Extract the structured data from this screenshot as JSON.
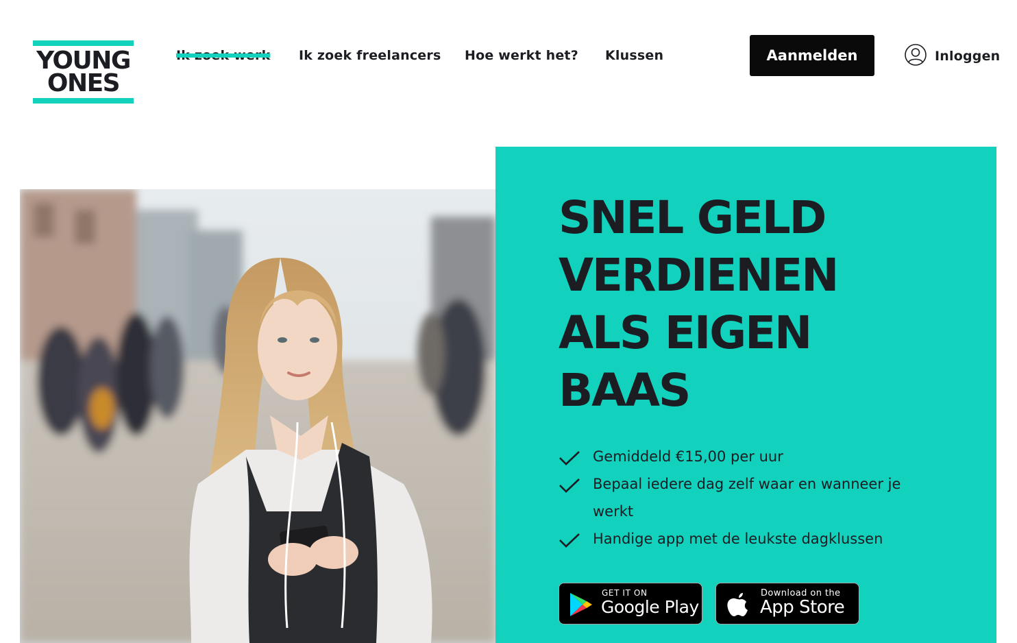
{
  "brand": {
    "logo_line1": "YOUNG",
    "logo_line2": "ONES",
    "accent_color": "#12d1bd"
  },
  "nav": {
    "items": [
      {
        "label": "Ik zoek werk",
        "active": true
      },
      {
        "label": "Ik zoek freelancers"
      },
      {
        "label": "Hoe werkt het?"
      },
      {
        "label": "Klussen"
      }
    ]
  },
  "header": {
    "signup_label": "Aanmelden",
    "login_label": "Inloggen",
    "login_icon": "user-circle-icon"
  },
  "hero": {
    "title_lines": [
      "SNEL GELD",
      "VERDIENEN",
      "ALS EIGEN",
      "BAAS"
    ],
    "benefits": [
      "Gemiddeld €15,00 per uur",
      "Bepaal iedere dag zelf waar en wanneer je werkt",
      "Handige app met de leukste dagklussen"
    ],
    "check_icon": "checkmark-icon",
    "panel_color": "#12d1bd"
  },
  "stores": {
    "google_play": {
      "small": "GET IT ON",
      "big": "Google Play",
      "icon": "google-play-icon"
    },
    "app_store": {
      "small": "Download on the",
      "big": "App Store",
      "icon": "apple-icon"
    }
  }
}
